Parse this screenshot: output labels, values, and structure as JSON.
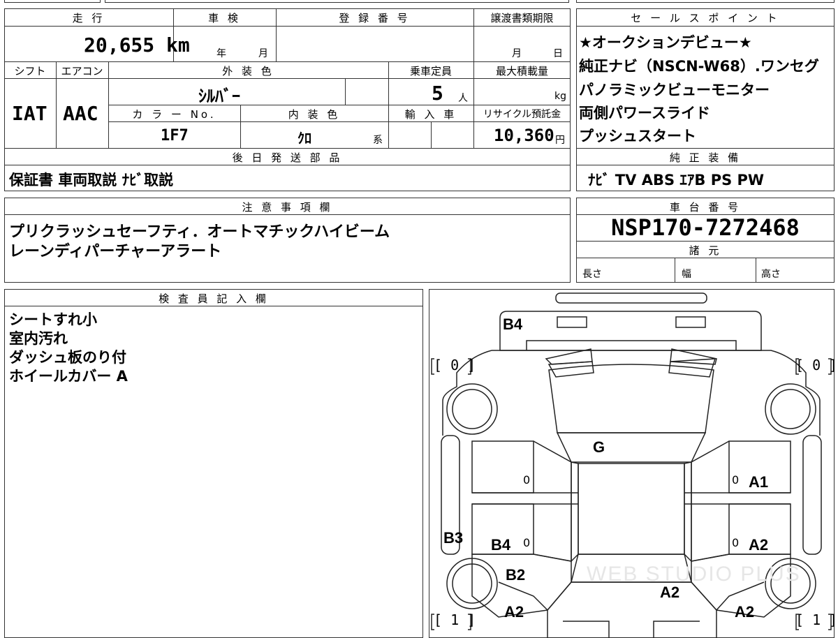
{
  "header": {
    "mileage_label": "走 行",
    "mileage_value": "20,655 km",
    "inspection_label": "車 検",
    "inspection_year": "年",
    "inspection_month": "月",
    "registration_label": "登 録 番 号",
    "transfer_label": "譲渡書類期限",
    "transfer_month": "月",
    "transfer_day": "日"
  },
  "specs": {
    "shift_label": "シフト",
    "shift_value": "IAT",
    "ac_label": "エアコン",
    "ac_value": "AAC",
    "exterior_label": "外 装 色",
    "exterior_value": "ｼﾙﾊﾞｰ",
    "capacity_label": "乗車定員",
    "capacity_value": "5",
    "capacity_unit": "人",
    "maxload_label": "最大積載量",
    "maxload_unit": "kg",
    "color_no_label": "カ ラ ー No.",
    "color_no_value": "1F7",
    "interior_label": "内 装 色",
    "interior_value": "ｸﾛ",
    "interior_unit": "系",
    "import_label": "輸 入 車",
    "recycle_label": "リサイクル預託金",
    "recycle_value": "10,360",
    "recycle_unit": "円"
  },
  "later": {
    "label": "後 日 発 送 部 品",
    "value": "保証書 車両取説 ﾅﾋﾞ取説"
  },
  "notes": {
    "label": "注 意 事 項 欄",
    "lines": [
      "プリクラッシュセーフティ．オートマチックハイビーム",
      "レーンディパーチャーアラート"
    ]
  },
  "sales": {
    "label": "セ ー ル ス ポ イ ン ト",
    "lines": [
      "★オークションデビュー★",
      "純正ナビ（NSCN-W68）.ワンセグ",
      "パノラミックビューモニター",
      "両側パワースライド",
      "プッシュスタート"
    ]
  },
  "equipment": {
    "label": "純 正 装 備",
    "value": "ﾅﾋﾞ  TV  ABS  ｴｱB  PS  PW"
  },
  "chassis": {
    "label": "車 台 番 号",
    "value": "NSP170-7272468"
  },
  "dims": {
    "label": "諸 元",
    "length": "長さ",
    "width": "幅",
    "height": "高さ"
  },
  "inspector": {
    "label": "検 査 員 記 入 欄",
    "lines": [
      "シートすれ小",
      "室内汚れ",
      "ダッシュ板のり付",
      "ホイールカバー A"
    ]
  },
  "diagram": {
    "marks": {
      "rear": "B4",
      "roof": "G",
      "r_door_front": "A1",
      "r_door_rear": "A2",
      "l_quarter": "B3",
      "l_door_rear": "B4",
      "l_fender_low": "B2",
      "l_front": "A2",
      "hood": "A2",
      "r_front": "A2"
    },
    "tires": {
      "rear_left": "[ 0 ]",
      "rear_right": "[ 0 ]",
      "front_left": "[ 1 ]",
      "front_right": "[ 1 ]"
    },
    "zeros": {
      "l_door_front": "0",
      "l_door_rear": "0",
      "r_door_front": "0",
      "r_door_rear": "0"
    }
  },
  "watermark": "WEB STUDIO PLUS"
}
